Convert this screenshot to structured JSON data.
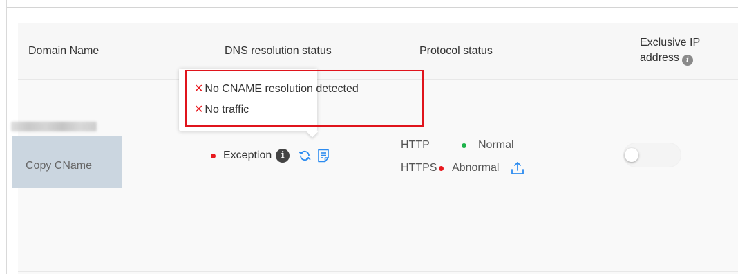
{
  "table": {
    "headers": {
      "domain_name": "Domain Name",
      "dns_status": "DNS resolution status",
      "protocol_status": "Protocol status",
      "exclusive_ip": "Exclusive IP address"
    },
    "row": {
      "copy_cname_label": "Copy CName",
      "dns": {
        "status_text": "Exception",
        "status_color": "#e8191e"
      },
      "tooltip": {
        "issues": [
          "No CNAME resolution detected",
          "No traffic"
        ],
        "mark": "✕"
      },
      "protocols": [
        {
          "name": "HTTP",
          "status": "Normal",
          "color": "#1db34a"
        },
        {
          "name": "HTTPS",
          "status": "Abnormal",
          "color": "#e8191e"
        }
      ],
      "exclusive_ip_enabled": false
    }
  },
  "icons": {
    "info": "info-icon",
    "refresh": "refresh-icon",
    "document": "document-icon",
    "upload": "upload-icon"
  },
  "colors": {
    "accent": "#2d8cf0",
    "highlight_border": "#e0141c",
    "copy_button_bg": "#cbd6e0"
  }
}
